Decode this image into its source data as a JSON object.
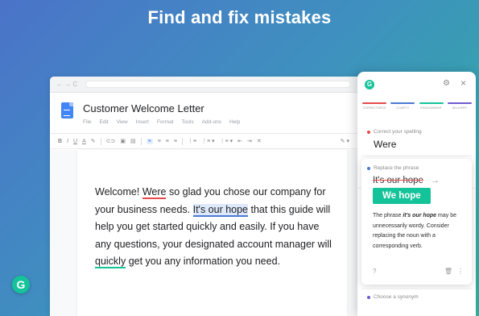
{
  "headline": "Find and fix mistakes",
  "browser": {
    "nav": "← → C"
  },
  "doc": {
    "title": "Customer Welcome Letter",
    "menu": [
      "File",
      "Edit",
      "View",
      "Insert",
      "Format",
      "Tools",
      "Add-ons",
      "Help"
    ]
  },
  "toolbar": {
    "items": [
      "B",
      "I",
      "U",
      "A",
      "✎",
      "⊂⊃",
      "▣",
      "▤"
    ],
    "align": [
      "≡",
      "≡",
      "≡",
      "≡"
    ],
    "lists": [
      "⋮≡",
      "⋮≡ ▾",
      "⋮≡ ▾",
      "⇤",
      "⇥",
      "✕"
    ],
    "pen": "✎ ▾"
  },
  "body": {
    "p1": "Welcome! ",
    "err1": "Were",
    "p2": " so glad you chose our company for your business needs. ",
    "hl": "It's our hope",
    "p3": " that this guide will help you get started quickly and easily. If you have any questions, your designated account manager will ",
    "err2": "quickly",
    "p4": " get you any information you need."
  },
  "grammarly": {
    "logo": "G",
    "goals_icon": "goals-icon",
    "tabs": [
      {
        "label": "CORRECTNESS",
        "color": "#e8484b"
      },
      {
        "label": "CLARITY",
        "color": "#4a7ad6"
      },
      {
        "label": "ENGAGEMENT",
        "color": "#15c39a"
      },
      {
        "label": "DELIVERY",
        "color": "#6d5bd0"
      }
    ],
    "card1": {
      "hint": "Correct your spelling",
      "word": "Were"
    },
    "card2": {
      "hint": "Replace the phrase",
      "strike": "It's our hope",
      "replacement": "We hope",
      "explain_1": "The phrase ",
      "explain_em": "it's our hope",
      "explain_2": " may be unnecessarily wordy. Consider replacing the noun with a corresponding verb."
    },
    "card3": {
      "hint": "Choose a synonym"
    }
  },
  "float_logo": "G",
  "colors": {
    "grammarly_green": "#15c39a",
    "error_red": "#e8484b",
    "clarity_blue": "#4a7ad6"
  }
}
